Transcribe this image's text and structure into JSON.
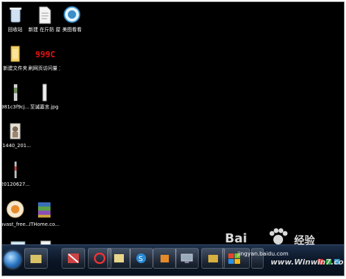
{
  "desktop": {
    "icons": [
      {
        "label": "回收站",
        "icon": "recycle-bin-icon"
      },
      {
        "label": "新建 在斤防 屋面.txt",
        "icon": "text-file-icon"
      },
      {
        "label": "美图看看",
        "icon": "image-viewer-icon"
      },
      {
        "label": "新建文件夹",
        "icon": "folder-icon"
      },
      {
        "label": "刷网页访问量 工具.exe",
        "icon": "exe-counter-icon"
      },
      {
        "label": "981c3f9cj...",
        "icon": "image-file-icon"
      },
      {
        "label": "至诚嘉言.jpg",
        "icon": "image-file-icon"
      },
      {
        "label": "71440_201...",
        "icon": "image-file-icon"
      },
      {
        "label": "20120627...",
        "icon": "image-file-icon"
      },
      {
        "label": "avast_free...",
        "icon": "avast-setup-icon"
      },
      {
        "label": "ITHome.co...",
        "icon": "winrar-archive-icon"
      }
    ]
  },
  "watermark": {
    "brand": "Bai",
    "brand_suffix": "经验",
    "url": "jingyan.baidu.com",
    "site": "www.Winwin7.com"
  },
  "taskbar": {
    "items": [
      "explorer",
      "media",
      "quick",
      "contacts",
      "sogou",
      "game",
      "monitor",
      "tools",
      "windows",
      "folder"
    ]
  },
  "colors": {
    "desktop": "#000000",
    "taskbar": "#0a1424"
  }
}
